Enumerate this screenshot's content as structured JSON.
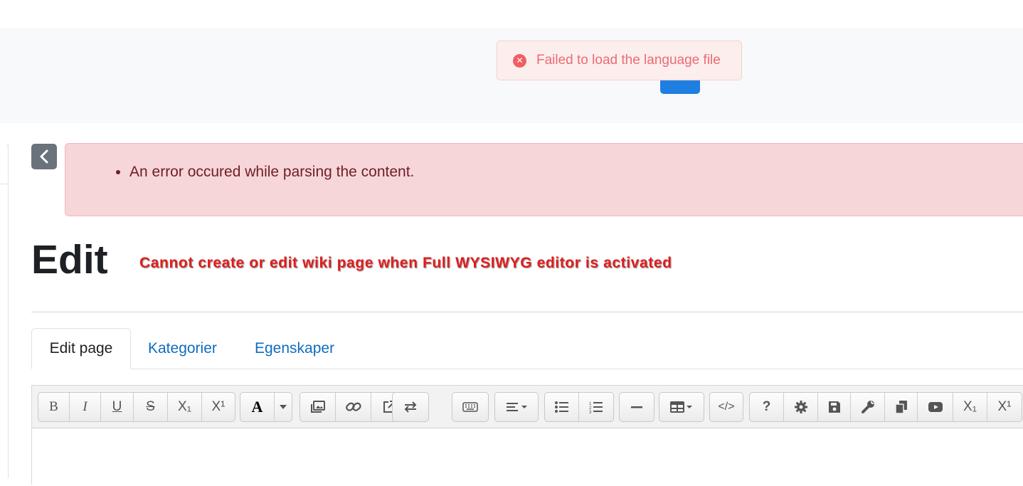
{
  "toast": {
    "message": "Failed to load the language file"
  },
  "alert": {
    "items": [
      "An error occured while parsing the content."
    ]
  },
  "page": {
    "title": "Edit",
    "notice": "Cannot create or edit wiki page when Full WYSIWYG editor is activated"
  },
  "tabs": [
    {
      "label": "Edit page"
    },
    {
      "label": "Kategorier"
    },
    {
      "label": "Egenskaper"
    }
  ],
  "toolbar": {
    "bold": "B",
    "italic": "I",
    "underline": "U",
    "strike": "S",
    "subscript": "X₁",
    "superscript": "X¹",
    "font_color": "A",
    "help": "?",
    "subscript2": "X₁",
    "superscript2": "X¹"
  }
}
